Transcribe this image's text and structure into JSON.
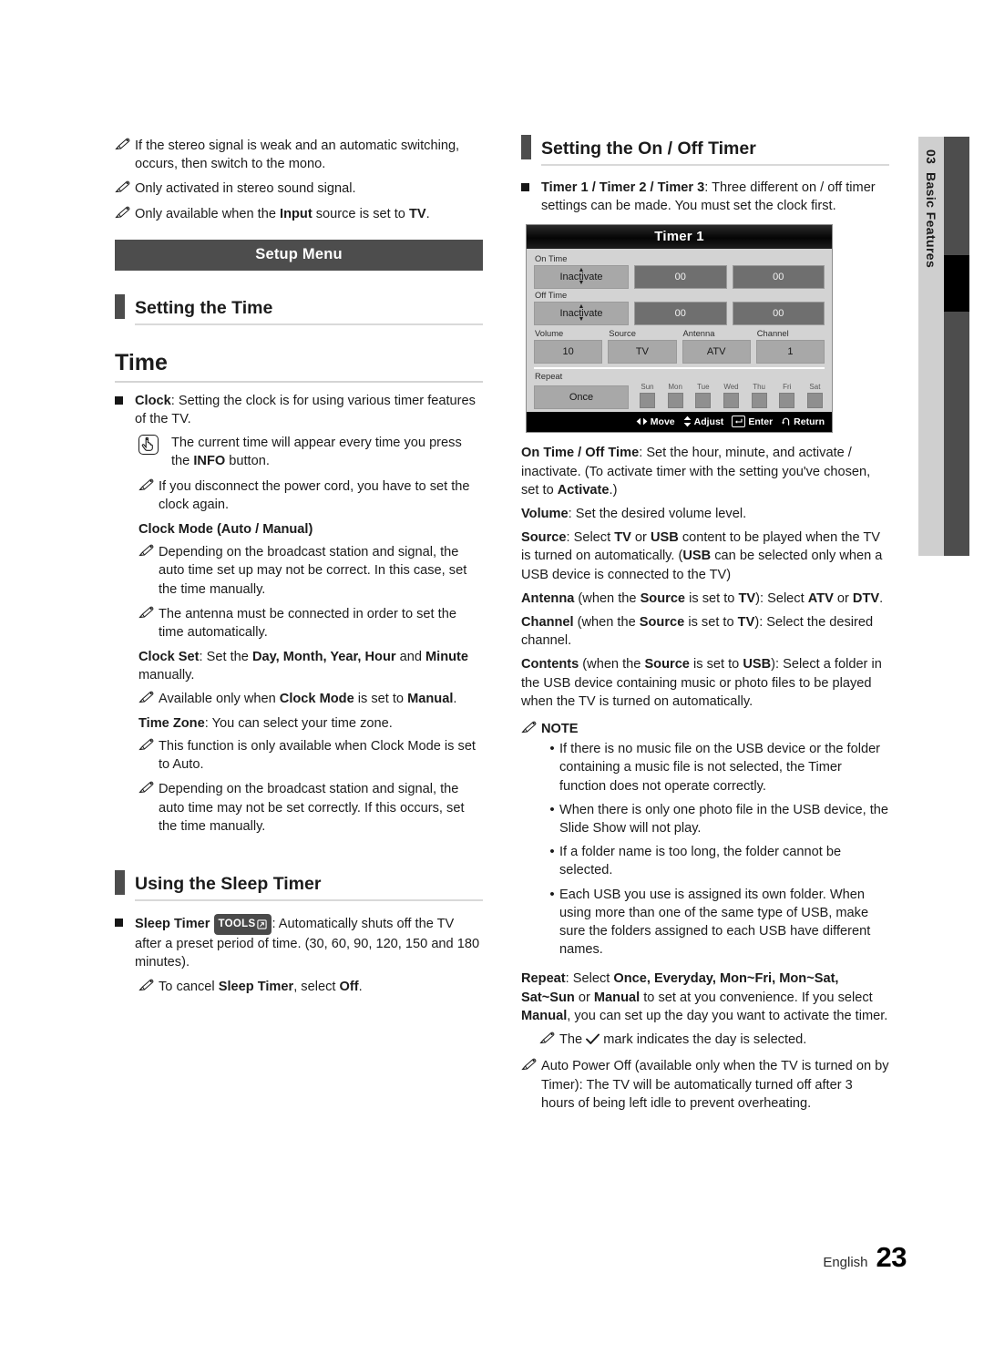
{
  "page": {
    "language_label": "English",
    "page_number": "23",
    "chapter_number": "03",
    "chapter_title": "Basic Features"
  },
  "left_column": {
    "top_notes": [
      "If the stereo signal is weak and an automatic switching, occurs, then switch to the mono.",
      "Only activated in stereo sound signal."
    ],
    "top_note_input": {
      "before": "Only available when the ",
      "bold1": "Input",
      "middle": " source is set to ",
      "bold2": "TV",
      "after": "."
    },
    "banner": "Setup Menu",
    "section_heading": "Setting the Time",
    "big_heading": "Time",
    "clock_item": {
      "bold": "Clock",
      "text": ": Setting the clock is for using various timer features of the TV."
    },
    "info_note": {
      "before": "The current time will appear every time you press the ",
      "bold": "INFO",
      "after": " button."
    },
    "power_cord_note": "If you disconnect the power cord, you have to set the clock again.",
    "clock_mode_heading": "Clock Mode (Auto / Manual)",
    "clock_mode_notes": [
      "Depending on the broadcast station and signal, the auto time set up may not be correct. In this case, set the time manually.",
      "The antenna must be connected in order to set the time automatically."
    ],
    "clock_set": {
      "bold": "Clock Set",
      "t1": ": Set the ",
      "bold2": "Day, Month, Year, Hour",
      "t2": " and ",
      "bold3": "Minute",
      "t3": " manually."
    },
    "clock_set_note": {
      "before": "Available only when ",
      "bold1": "Clock Mode",
      "middle": " is set to ",
      "bold2": "Manual",
      "after": "."
    },
    "time_zone": {
      "bold": "Time Zone",
      "text": ": You can select your time zone."
    },
    "time_zone_notes": [
      "This function is only available when Clock Mode is set to Auto.",
      "Depending on the broadcast station and signal, the auto time may not be set correctly. If this occurs, set the time manually."
    ],
    "sleep_section_heading": "Using the Sleep Timer",
    "sleep_timer": {
      "bold": "Sleep Timer",
      "badge": "TOOLS",
      "text": ": Automatically shuts off the TV after a preset period of time. (30, 60, 90, 120, 150 and 180 minutes)."
    },
    "sleep_note": {
      "before": "To cancel ",
      "bold1": "Sleep Timer",
      "middle": ", select ",
      "bold2": "Off",
      "after": "."
    }
  },
  "right_column": {
    "section_heading": "Setting the On / Off Timer",
    "timer_item": {
      "bold": "Timer 1 / Timer 2 / Timer 3",
      "text": ": Three different on / off timer settings can be made. You must set the clock first."
    },
    "tv_menu": {
      "title": "Timer 1",
      "on_time_label": "On Time",
      "off_time_label": "Off Time",
      "on_time": {
        "state": "Inactivate",
        "hour": "00",
        "minute": "00"
      },
      "off_time": {
        "state": "Inactivate",
        "hour": "00",
        "minute": "00"
      },
      "fields": [
        {
          "label": "Volume",
          "value": "10"
        },
        {
          "label": "Source",
          "value": "TV"
        },
        {
          "label": "Antenna",
          "value": "ATV"
        },
        {
          "label": "Channel",
          "value": "1"
        }
      ],
      "repeat_label": "Repeat",
      "repeat_value": "Once",
      "days": [
        "Sun",
        "Mon",
        "Tue",
        "Wed",
        "Thu",
        "Fri",
        "Sat"
      ],
      "footer": {
        "move": "Move",
        "adjust": "Adjust",
        "enter": "Enter",
        "return": "Return"
      }
    },
    "on_off_time": {
      "bold": "On Time / Off Time",
      "t1": ": Set the hour, minute, and activate / inactivate. (To activate timer with the setting you've chosen, set to ",
      "bold2": "Activate",
      "t2": ".)"
    },
    "volume": {
      "bold": "Volume",
      "text": ": Set the desired volume level."
    },
    "source": {
      "bold": "Source",
      "t1": ": Select ",
      "bold2": "TV",
      "t2": " or ",
      "bold3": "USB",
      "t3": " content to be played when the TV is turned on automatically. (",
      "bold4": "USB",
      "t4": " can be selected only when a USB device is connected to the TV)"
    },
    "antenna": {
      "bold": "Antenna",
      "t1": " (when the ",
      "bold2": "Source",
      "t2": " is set to ",
      "bold3": "TV",
      "t3": "): Select ",
      "bold4": "ATV",
      "t4": " or ",
      "bold5": "DTV",
      "t5": "."
    },
    "channel": {
      "bold": "Channel",
      "t1": " (when the ",
      "bold2": "Source",
      "t2": " is set to ",
      "bold3": "TV",
      "t3": "): Select the desired channel."
    },
    "contents": {
      "bold": "Contents",
      "t1": " (when the ",
      "bold2": "Source",
      "t2": " is set to ",
      "bold3": "USB",
      "t3": "): Select a folder in the USB device containing music or photo files to be played when the TV is turned on automatically."
    },
    "note_heading": "NOTE",
    "note_bullets": [
      "If there is no music file on the USB device or the folder containing a music file is not selected, the Timer function does not operate correctly.",
      "When there is only one photo file in the USB device, the Slide Show will not play.",
      "If a folder name is too long, the folder cannot be selected.",
      "Each USB you use is assigned its own folder. When using more than one of the same type of USB, make sure the folders assigned to each USB have different names."
    ],
    "repeat": {
      "bold": "Repeat",
      "t1": ": Select ",
      "bold2": "Once, Everyday, Mon~Fri, Mon~Sat, Sat~Sun",
      "t2": " or ",
      "bold3": "Manual",
      "t3": " to set at you convenience. If you select ",
      "bold4": "Manual",
      "t4": ", you can set up the day you want to activate the timer."
    },
    "check_note": {
      "before": "The ",
      "after": " mark indicates the day is selected."
    },
    "auto_power_off": "Auto Power Off (available only when the TV is turned on by Timer): The TV will be automatically turned off after 3 hours of being left idle to prevent overheating."
  }
}
